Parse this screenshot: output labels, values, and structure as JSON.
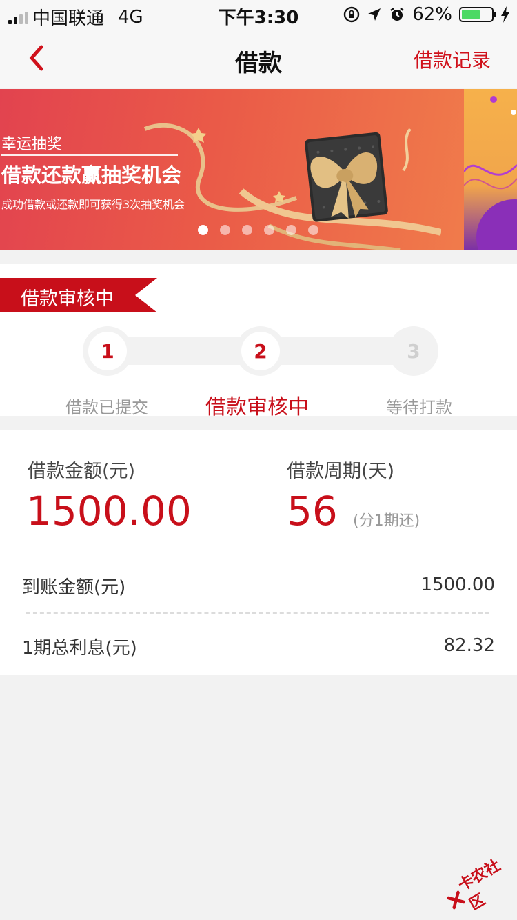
{
  "status_bar": {
    "carrier": "中国联通",
    "network": "4G",
    "time": "下午3:30",
    "battery": "62%",
    "battery_level": 0.62
  },
  "nav": {
    "title": "借款",
    "right_link": "借款记录",
    "accent_color": "#d0111b"
  },
  "banner": {
    "tag": "幸运抽奖",
    "title": "借款还款赢抽奖机会",
    "subtitle": "成功借款或还款即可获得3次抽奖机会",
    "slide_count": 6,
    "active_slide": 1
  },
  "loan_status": {
    "badge": "借款审核中",
    "steps": [
      {
        "number": "1",
        "label": "借款已提交"
      },
      {
        "number": "2",
        "label": "借款审核中"
      },
      {
        "number": "3",
        "label": "等待打款"
      }
    ],
    "current_step": 2
  },
  "loan": {
    "amount_label": "借款金额(元)",
    "amount": "1500.00",
    "period_label": "借款周期(天)",
    "period": "56",
    "period_note": "(分1期还)",
    "received_label": "到账金额(元)",
    "received_value": "1500.00",
    "interest_label": "1期总利息(元)",
    "interest_value": "82.32"
  },
  "watermark": {
    "text": "卡农社区"
  }
}
